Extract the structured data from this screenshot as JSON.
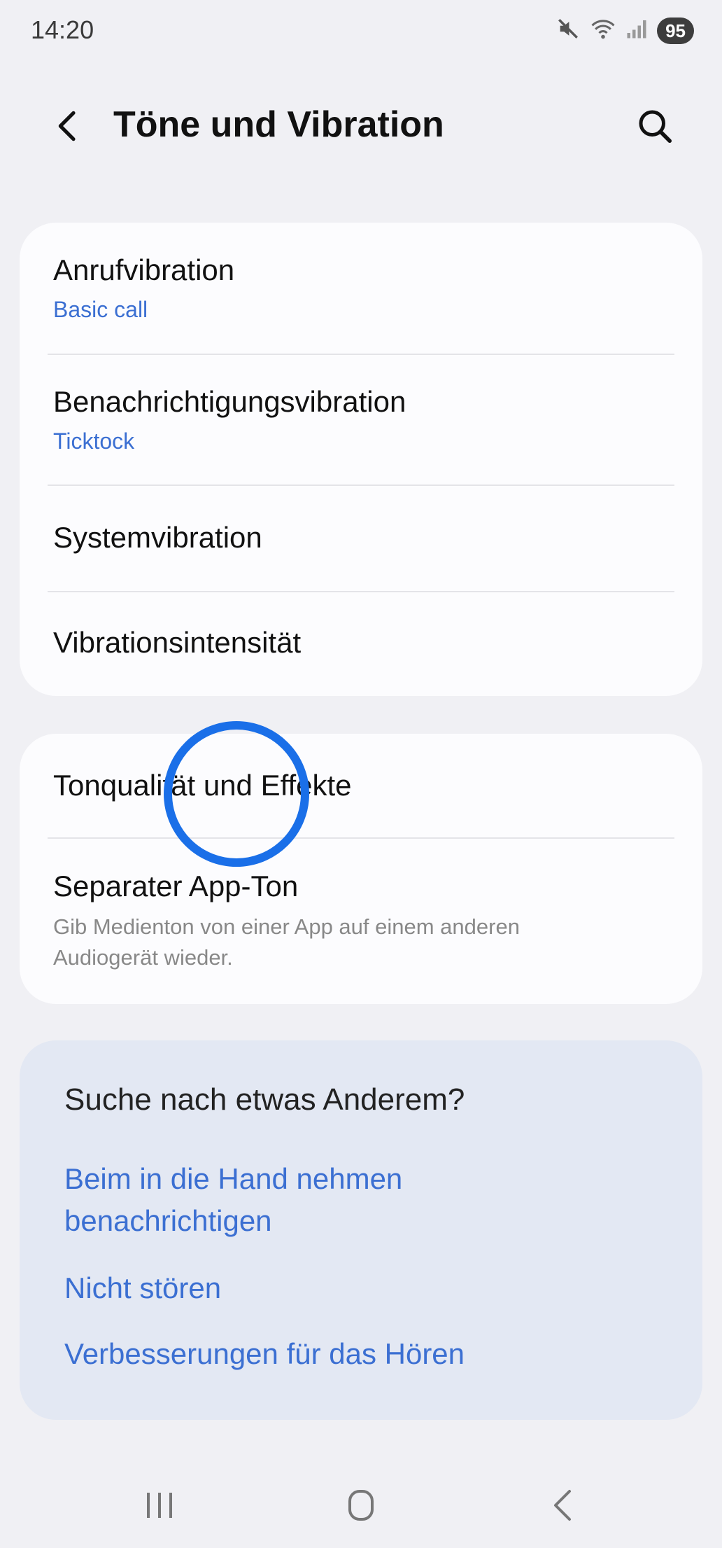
{
  "status_bar": {
    "time": "14:20",
    "battery": "95"
  },
  "header": {
    "title": "Töne und Vibration"
  },
  "vibration_card": {
    "items": [
      {
        "title": "Anrufvibration",
        "subtitle": "Basic call"
      },
      {
        "title": "Benachrichtigungsvibration",
        "subtitle": "Ticktock"
      },
      {
        "title": "Systemvibration"
      },
      {
        "title": "Vibrationsintensität"
      }
    ]
  },
  "sound_card": {
    "items": [
      {
        "title": "Tonqualität und Effekte"
      },
      {
        "title": "Separater App-Ton",
        "description": "Gib Medienton von einer App auf einem anderen Audiogerät wieder."
      }
    ]
  },
  "suggestions": {
    "title": "Suche nach etwas Anderem?",
    "links": [
      "Beim in die Hand nehmen benachrichtigen",
      "Nicht stören",
      "Verbesserungen für das Hören"
    ]
  },
  "colors": {
    "accent": "#3b6fd2",
    "touch_indicator": "#1a6fe8",
    "background": "#f0f0f4",
    "suggestion_card": "#e3e8f3"
  },
  "icons": [
    "mute-icon",
    "wifi-icon",
    "signal-icon",
    "back-icon",
    "search-icon",
    "recents-icon",
    "home-icon",
    "nav-back-icon"
  ]
}
